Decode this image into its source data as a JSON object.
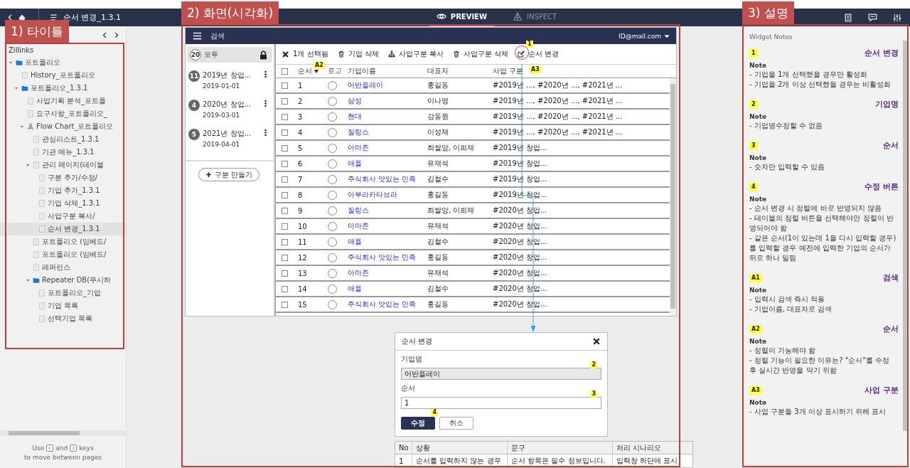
{
  "top_bar": {
    "title": "순서 변경_1.3.1",
    "modes": [
      {
        "label": "PREVIEW",
        "kind": "eye",
        "selected": true
      },
      {
        "label": "INSPECT",
        "kind": "inspect",
        "selected": false
      }
    ]
  },
  "annotations": [
    {
      "label": "1) 타이틀"
    },
    {
      "label": "2) 화면(시각화)"
    },
    {
      "label": "3) 설명"
    }
  ],
  "sidebar": {
    "project": "Zillinks",
    "tree": [
      {
        "label": "포트폴리오",
        "kind": "folder",
        "selected": false,
        "expanded": true,
        "children": [
          {
            "label": "History_포트폴리오",
            "kind": "page",
            "selected": false
          },
          {
            "label": "포트폴리오_1.3.1",
            "kind": "folder",
            "selected": false,
            "expanded": true,
            "children": [
              {
                "label": "사업기획 분석_포트폴",
                "kind": "page",
                "selected": false
              },
              {
                "label": "요구사항_포트폴리오_",
                "kind": "page",
                "selected": false
              },
              {
                "label": "Flow Chart_포트폴리오",
                "kind": "flow",
                "selected": false,
                "expanded": true,
                "children": [
                  {
                    "label": "관심리스트_1.3.1",
                    "kind": "page",
                    "selected": false
                  },
                  {
                    "label": "기관 메뉴_1.3.1",
                    "kind": "page",
                    "selected": false
                  },
                  {
                    "label": "관리 페이지(테이블",
                    "kind": "page",
                    "selected": false,
                    "expanded": true,
                    "children": [
                      {
                        "label": "구분 추가/수정/",
                        "kind": "page",
                        "selected": false
                      },
                      {
                        "label": "기업 추가_1.3.1",
                        "kind": "page",
                        "selected": false
                      },
                      {
                        "label": "기업 삭제_1.3.1",
                        "kind": "page",
                        "selected": false
                      },
                      {
                        "label": "사업구분 복사/",
                        "kind": "page",
                        "selected": false
                      },
                      {
                        "label": "순서 변경_1.3.1",
                        "kind": "page",
                        "selected": true
                      }
                    ]
                  },
                  {
                    "label": "포트폴리오 (임베드/",
                    "kind": "page",
                    "selected": false
                  },
                  {
                    "label": "포트폴리오 (임베드/",
                    "kind": "page",
                    "selected": false
                  },
                  {
                    "label": "레퍼런스",
                    "kind": "page",
                    "selected": false
                  },
                  {
                    "label": "Repeater DB(무시하",
                    "kind": "folder",
                    "selected": false,
                    "expanded": true,
                    "children": [
                      {
                        "label": "포트폴리오_기업",
                        "kind": "page",
                        "selected": false
                      },
                      {
                        "label": "기업 목록",
                        "kind": "page",
                        "selected": false
                      },
                      {
                        "label": "선택기업 목록",
                        "kind": "page",
                        "selected": false
                      }
                    ]
                  }
                ]
              }
            ]
          }
        ]
      }
    ],
    "hint": {
      "before": "Use",
      "middle": "and",
      "after": "keys",
      "second_line": "to move between pages"
    }
  },
  "mockup": {
    "search_label": "검색",
    "account": "ID@mail.com",
    "groups": [
      {
        "count": "20",
        "label": "모두",
        "locked": true,
        "selected": true
      },
      {
        "count": "11",
        "label": "2019년 창업...",
        "date": "2019-01-01",
        "locked": false,
        "selected": false
      },
      {
        "count": "4",
        "label": "2020년 창업...",
        "date": "2019-03-01",
        "locked": false,
        "selected": false
      },
      {
        "count": "5",
        "label": "2021년 창업...",
        "date": "2019-04-01",
        "locked": false,
        "selected": false
      }
    ],
    "new_group_button": "구분 만들기",
    "all_checked": false,
    "toolbar": [
      {
        "kind": "close",
        "label": "1개 선택됨"
      },
      {
        "kind": "trash",
        "label": "기업 삭제"
      },
      {
        "kind": "org",
        "label": "사업구분 복사"
      },
      {
        "kind": "trash",
        "label": "사업구분 삭제"
      },
      {
        "kind": "edit",
        "label": "순서 변경",
        "badge": "1"
      }
    ],
    "columns": [
      {
        "label": "순서",
        "badge": "A2",
        "sorted": true
      },
      {
        "label": "로고",
        "sorted": false
      },
      {
        "label": "기업이름",
        "sorted": false
      },
      {
        "label": "대표자",
        "sorted": false
      },
      {
        "label": "사업 구분",
        "badge": "A3",
        "sorted": false
      }
    ],
    "rows": [
      {
        "order": "1",
        "company": "어반플레이",
        "ceo": "홍길동",
        "tags": "#2019년 ..., #2020년 ..., #2021년 ...",
        "checked": false
      },
      {
        "order": "2",
        "company": "삼성",
        "ceo": "이나영",
        "tags": "#2019년 ..., #2020년 ..., #2021년 ...",
        "checked": false
      },
      {
        "order": "3",
        "company": "현대",
        "ceo": "강동원",
        "tags": "#2019년 ..., #2020년 ..., #2021년 ...",
        "checked": false
      },
      {
        "order": "4",
        "company": "질링스",
        "ceo": "이성재",
        "tags": "#2019년 ..., #2020년 ..., #2021년 ...",
        "checked": false
      },
      {
        "order": "5",
        "company": "아마존",
        "ceo": "최쌀앙, 이희재",
        "tags": "#2019년 창업...",
        "checked": false
      },
      {
        "order": "6",
        "company": "애플",
        "ceo": "유재석",
        "tags": "#2019년 창업...",
        "checked": false
      },
      {
        "order": "7",
        "company": "주식회사 맛있는 민족",
        "ceo": "김철수",
        "tags": "#2019년 창업...",
        "checked": false
      },
      {
        "order": "8",
        "company": "아부라카타브라",
        "ceo": "홍길동",
        "tags": "#2019년 창업...",
        "checked": false
      },
      {
        "order": "9",
        "company": "질링스",
        "ceo": "최쌀앙, 이희재",
        "tags": "#2020년 창업...",
        "checked": false
      },
      {
        "order": "10",
        "company": "아마존",
        "ceo": "유재석",
        "tags": "#2020년 창업...",
        "checked": false
      },
      {
        "order": "11",
        "company": "애플",
        "ceo": "김철수",
        "tags": "#2020년 창업...",
        "checked": false
      },
      {
        "order": "12",
        "company": "주식회사 맛있는 민족",
        "ceo": "홍길동",
        "tags": "#2020년 창업...",
        "checked": false
      },
      {
        "order": "13",
        "company": "아마존",
        "ceo": "유재석",
        "tags": "#2020년 창업...",
        "checked": false
      },
      {
        "order": "14",
        "company": "애플",
        "ceo": "김철수",
        "tags": "#2020년 창업...",
        "checked": false
      },
      {
        "order": "15",
        "company": "주식회사 맛있는 민족",
        "ceo": "홍길동",
        "tags": "#2020년 창업...",
        "checked": false
      }
    ]
  },
  "modal": {
    "title": "순서 변경",
    "fields": [
      {
        "label": "기업명",
        "value": "어반플레이",
        "disabled": true,
        "badge": "2"
      },
      {
        "label": "순서",
        "value": "1",
        "disabled": false,
        "badge": "3"
      }
    ],
    "buttons": [
      {
        "label": "수정",
        "primary": true,
        "badge": "4"
      },
      {
        "label": "취소",
        "primary": false
      }
    ]
  },
  "message_table": {
    "columns": [
      "No",
      "상황",
      "문구",
      "처리 시나리오"
    ],
    "rows": [
      [
        "1",
        "순서를 입력하지 않는 경우",
        "순서 항목은 필수 정보입니다.",
        "입력창 하단에 표시"
      ]
    ]
  },
  "notes": {
    "title": "Widget Notes",
    "items": [
      {
        "badge": "1",
        "title": "순서 변경",
        "heading": "Note",
        "lines": [
          "- 기업을 1개 선택했을 경우만 활성화",
          "- 기업을 2개 이상 선택했을 경우는 비활성화"
        ]
      },
      {
        "badge": "2",
        "title": "기업명",
        "heading": "Note",
        "lines": [
          "- 기업명수정할 수 없음"
        ]
      },
      {
        "badge": "3",
        "title": "순서",
        "heading": "Note",
        "lines": [
          "- 숫자만 입력할 수 있음"
        ]
      },
      {
        "badge": "4",
        "title": "수정 버튼",
        "heading": "Note",
        "lines": [
          "- 순서 변경 시 정렬에 바로 반영되지 않음",
          "- 테이블의 정렬 버튼을 선택해야만 정렬이 반영되어야 함",
          "- 같은 순서(1이 있는데 1을 다시 입력할 경우)를 입력할 경우 예전에 입력한 기업의 순서가 뒤로 하나 밀림"
        ]
      },
      {
        "badge": "A1",
        "title": "검색",
        "heading": "Note",
        "lines": [
          "- 입력시 검색 즉시 적용",
          "- 기업이름, 대표자로 검색"
        ]
      },
      {
        "badge": "A2",
        "title": "순서",
        "heading": "Note",
        "lines": [
          "- 정렬이 가능해야 함",
          "- 정렬 기능이 필요한 이유는? \"순서\"를 수정 후 실시간 반영을 막기 위함"
        ]
      },
      {
        "badge": "A3",
        "title": "사업 구분",
        "heading": "Note",
        "lines": [
          "- 사업 구분을 3개 이상 표시하기 위해 표시"
        ]
      }
    ]
  }
}
